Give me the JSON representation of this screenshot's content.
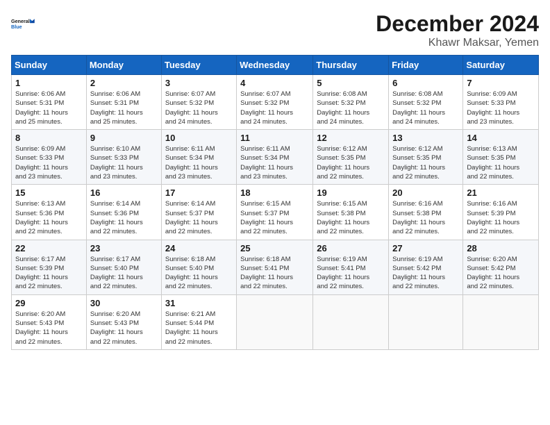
{
  "header": {
    "logo_line1": "General",
    "logo_line2": "Blue",
    "month_title": "December 2024",
    "subtitle": "Khawr Maksar, Yemen"
  },
  "days_of_week": [
    "Sunday",
    "Monday",
    "Tuesday",
    "Wednesday",
    "Thursday",
    "Friday",
    "Saturday"
  ],
  "weeks": [
    [
      {
        "day": "1",
        "info": "Sunrise: 6:06 AM\nSunset: 5:31 PM\nDaylight: 11 hours\nand 25 minutes."
      },
      {
        "day": "2",
        "info": "Sunrise: 6:06 AM\nSunset: 5:31 PM\nDaylight: 11 hours\nand 25 minutes."
      },
      {
        "day": "3",
        "info": "Sunrise: 6:07 AM\nSunset: 5:32 PM\nDaylight: 11 hours\nand 24 minutes."
      },
      {
        "day": "4",
        "info": "Sunrise: 6:07 AM\nSunset: 5:32 PM\nDaylight: 11 hours\nand 24 minutes."
      },
      {
        "day": "5",
        "info": "Sunrise: 6:08 AM\nSunset: 5:32 PM\nDaylight: 11 hours\nand 24 minutes."
      },
      {
        "day": "6",
        "info": "Sunrise: 6:08 AM\nSunset: 5:32 PM\nDaylight: 11 hours\nand 24 minutes."
      },
      {
        "day": "7",
        "info": "Sunrise: 6:09 AM\nSunset: 5:33 PM\nDaylight: 11 hours\nand 23 minutes."
      }
    ],
    [
      {
        "day": "8",
        "info": "Sunrise: 6:09 AM\nSunset: 5:33 PM\nDaylight: 11 hours\nand 23 minutes."
      },
      {
        "day": "9",
        "info": "Sunrise: 6:10 AM\nSunset: 5:33 PM\nDaylight: 11 hours\nand 23 minutes."
      },
      {
        "day": "10",
        "info": "Sunrise: 6:11 AM\nSunset: 5:34 PM\nDaylight: 11 hours\nand 23 minutes."
      },
      {
        "day": "11",
        "info": "Sunrise: 6:11 AM\nSunset: 5:34 PM\nDaylight: 11 hours\nand 23 minutes."
      },
      {
        "day": "12",
        "info": "Sunrise: 6:12 AM\nSunset: 5:35 PM\nDaylight: 11 hours\nand 22 minutes."
      },
      {
        "day": "13",
        "info": "Sunrise: 6:12 AM\nSunset: 5:35 PM\nDaylight: 11 hours\nand 22 minutes."
      },
      {
        "day": "14",
        "info": "Sunrise: 6:13 AM\nSunset: 5:35 PM\nDaylight: 11 hours\nand 22 minutes."
      }
    ],
    [
      {
        "day": "15",
        "info": "Sunrise: 6:13 AM\nSunset: 5:36 PM\nDaylight: 11 hours\nand 22 minutes."
      },
      {
        "day": "16",
        "info": "Sunrise: 6:14 AM\nSunset: 5:36 PM\nDaylight: 11 hours\nand 22 minutes."
      },
      {
        "day": "17",
        "info": "Sunrise: 6:14 AM\nSunset: 5:37 PM\nDaylight: 11 hours\nand 22 minutes."
      },
      {
        "day": "18",
        "info": "Sunrise: 6:15 AM\nSunset: 5:37 PM\nDaylight: 11 hours\nand 22 minutes."
      },
      {
        "day": "19",
        "info": "Sunrise: 6:15 AM\nSunset: 5:38 PM\nDaylight: 11 hours\nand 22 minutes."
      },
      {
        "day": "20",
        "info": "Sunrise: 6:16 AM\nSunset: 5:38 PM\nDaylight: 11 hours\nand 22 minutes."
      },
      {
        "day": "21",
        "info": "Sunrise: 6:16 AM\nSunset: 5:39 PM\nDaylight: 11 hours\nand 22 minutes."
      }
    ],
    [
      {
        "day": "22",
        "info": "Sunrise: 6:17 AM\nSunset: 5:39 PM\nDaylight: 11 hours\nand 22 minutes."
      },
      {
        "day": "23",
        "info": "Sunrise: 6:17 AM\nSunset: 5:40 PM\nDaylight: 11 hours\nand 22 minutes."
      },
      {
        "day": "24",
        "info": "Sunrise: 6:18 AM\nSunset: 5:40 PM\nDaylight: 11 hours\nand 22 minutes."
      },
      {
        "day": "25",
        "info": "Sunrise: 6:18 AM\nSunset: 5:41 PM\nDaylight: 11 hours\nand 22 minutes."
      },
      {
        "day": "26",
        "info": "Sunrise: 6:19 AM\nSunset: 5:41 PM\nDaylight: 11 hours\nand 22 minutes."
      },
      {
        "day": "27",
        "info": "Sunrise: 6:19 AM\nSunset: 5:42 PM\nDaylight: 11 hours\nand 22 minutes."
      },
      {
        "day": "28",
        "info": "Sunrise: 6:20 AM\nSunset: 5:42 PM\nDaylight: 11 hours\nand 22 minutes."
      }
    ],
    [
      {
        "day": "29",
        "info": "Sunrise: 6:20 AM\nSunset: 5:43 PM\nDaylight: 11 hours\nand 22 minutes."
      },
      {
        "day": "30",
        "info": "Sunrise: 6:20 AM\nSunset: 5:43 PM\nDaylight: 11 hours\nand 22 minutes."
      },
      {
        "day": "31",
        "info": "Sunrise: 6:21 AM\nSunset: 5:44 PM\nDaylight: 11 hours\nand 22 minutes."
      },
      {
        "day": "",
        "info": ""
      },
      {
        "day": "",
        "info": ""
      },
      {
        "day": "",
        "info": ""
      },
      {
        "day": "",
        "info": ""
      }
    ]
  ]
}
